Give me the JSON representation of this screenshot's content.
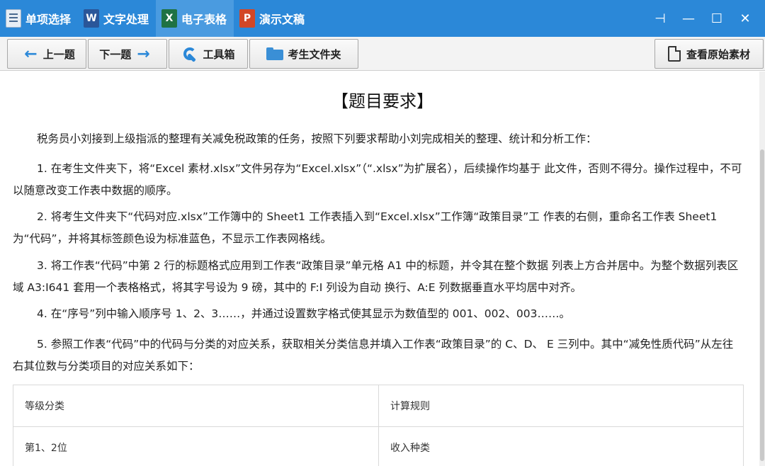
{
  "titlebar": {
    "tabs": [
      {
        "label": "单项选择",
        "icon": "checklist-icon",
        "active": false
      },
      {
        "label": "文字处理",
        "icon": "word-icon",
        "active": false
      },
      {
        "label": "电子表格",
        "icon": "excel-icon",
        "active": true
      },
      {
        "label": "演示文稿",
        "icon": "powerpoint-icon",
        "active": false
      }
    ],
    "accent": "#2b88d8"
  },
  "toolbar": {
    "prev_label": "上一题",
    "next_label": "下一题",
    "tools_label": "工具箱",
    "folder_label": "考生文件夹",
    "view_label": "查看原始素材"
  },
  "content": {
    "title": "【题目要求】",
    "intro": "税务员小刘接到上级指派的整理有关减免税政策的任务，按照下列要求帮助小刘完成相关的整理、统计和分析工作：",
    "items": [
      "1. 在考生文件夹下，将“Excel 素材.xlsx”文件另存为“Excel.xlsx”（“.xlsx”为扩展名），后续操作均基于 此文件，否则不得分。操作过程中，不可以随意改变工作表中数据的顺序。",
      "2. 将考生文件夹下“代码对应.xlsx”工作簿中的 Sheet1 工作表插入到“Excel.xlsx”工作簿“政策目录”工 作表的右侧，重命名工作表 Sheet1 为“代码”，并将其标签颜色设为标准蓝色，不显示工作表网格线。",
      "3. 将工作表“代码”中第 2 行的标题格式应用到工作表“政策目录”单元格 A1 中的标题，并令其在整个数据 列表上方合并居中。为整个数据列表区域 A3:I641 套用一个表格格式，将其字号设为 9 磅，其中的 F:I 列设为自动 换行、A:E 列数据垂直水平均居中对齐。",
      "4. 在“序号”列中输入顺序号 1、2、3……，并通过设置数字格式使其显示为数值型的 001、002、003……。",
      "5. 参照工作表“代码”中的代码与分类的对应关系，获取相关分类信息并填入工作表“政策目录”的 C、D、 E 三列中。其中“减免性质代码”从左往右其位数与分类项目的对应关系如下："
    ],
    "table": {
      "headers": [
        "等级分类",
        "计算规则"
      ],
      "rows": [
        [
          "第1、2位",
          "收入种类"
        ]
      ]
    }
  }
}
